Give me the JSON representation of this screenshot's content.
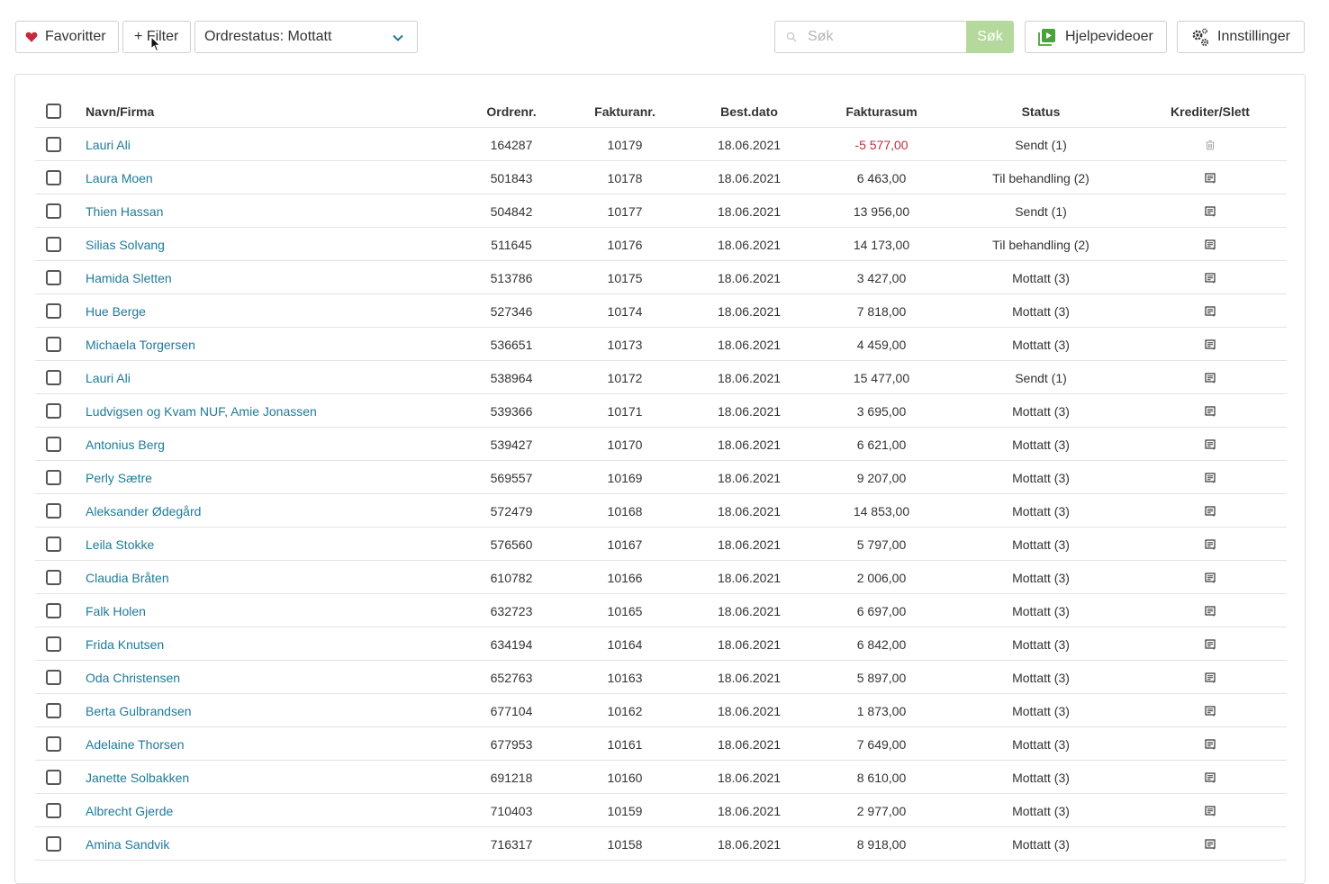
{
  "toolbar": {
    "favorites_label": "Favoritter",
    "filter_label": "+ Filter",
    "status_select_value": "Ordrestatus: Mottatt",
    "search_placeholder": "Søk",
    "search_button_label": "Søk",
    "help_videos_label": "Hjelpevideoer",
    "settings_label": "Innstillinger"
  },
  "colors": {
    "accent_link": "#1f7a99",
    "negative_amount": "#b8303f",
    "search_button": "#b5d99c",
    "heart": "#c8283c",
    "help_icon": "#4aa33a"
  },
  "table": {
    "headers": {
      "name": "Navn/Firma",
      "order_no": "Ordrenr.",
      "invoice_no": "Fakturanr.",
      "order_date": "Best.dato",
      "invoice_sum": "Fakturasum",
      "status": "Status",
      "credit_delete": "Krediter/Slett"
    },
    "rows": [
      {
        "name": "Lauri Ali",
        "order_no": "164287",
        "invoice_no": "10179",
        "date": "18.06.2021",
        "sum": "-5 577,00",
        "status": "Sendt (1)",
        "action_icon": "trash-icon"
      },
      {
        "name": "Laura Moen",
        "order_no": "501843",
        "invoice_no": "10178",
        "date": "18.06.2021",
        "sum": "6 463,00",
        "status": "Til behandling (2)",
        "action_icon": "credit-note-icon"
      },
      {
        "name": "Thien Hassan",
        "order_no": "504842",
        "invoice_no": "10177",
        "date": "18.06.2021",
        "sum": "13 956,00",
        "status": "Sendt (1)",
        "action_icon": "credit-note-icon"
      },
      {
        "name": "Silias Solvang",
        "order_no": "511645",
        "invoice_no": "10176",
        "date": "18.06.2021",
        "sum": "14 173,00",
        "status": "Til behandling (2)",
        "action_icon": "credit-note-icon"
      },
      {
        "name": "Hamida Sletten",
        "order_no": "513786",
        "invoice_no": "10175",
        "date": "18.06.2021",
        "sum": "3 427,00",
        "status": "Mottatt (3)",
        "action_icon": "credit-note-icon"
      },
      {
        "name": "Hue Berge",
        "order_no": "527346",
        "invoice_no": "10174",
        "date": "18.06.2021",
        "sum": "7 818,00",
        "status": "Mottatt (3)",
        "action_icon": "credit-note-icon"
      },
      {
        "name": "Michaela Torgersen",
        "order_no": "536651",
        "invoice_no": "10173",
        "date": "18.06.2021",
        "sum": "4 459,00",
        "status": "Mottatt (3)",
        "action_icon": "credit-note-icon"
      },
      {
        "name": "Lauri Ali",
        "order_no": "538964",
        "invoice_no": "10172",
        "date": "18.06.2021",
        "sum": "15 477,00",
        "status": "Sendt (1)",
        "action_icon": "credit-note-icon"
      },
      {
        "name": "Ludvigsen og Kvam NUF, Amie Jonassen",
        "order_no": "539366",
        "invoice_no": "10171",
        "date": "18.06.2021",
        "sum": "3 695,00",
        "status": "Mottatt (3)",
        "action_icon": "credit-note-icon"
      },
      {
        "name": "Antonius Berg",
        "order_no": "539427",
        "invoice_no": "10170",
        "date": "18.06.2021",
        "sum": "6 621,00",
        "status": "Mottatt (3)",
        "action_icon": "credit-note-icon"
      },
      {
        "name": "Perly Sætre",
        "order_no": "569557",
        "invoice_no": "10169",
        "date": "18.06.2021",
        "sum": "9 207,00",
        "status": "Mottatt (3)",
        "action_icon": "credit-note-icon"
      },
      {
        "name": "Aleksander Ødegård",
        "order_no": "572479",
        "invoice_no": "10168",
        "date": "18.06.2021",
        "sum": "14 853,00",
        "status": "Mottatt (3)",
        "action_icon": "credit-note-icon"
      },
      {
        "name": "Leila Stokke",
        "order_no": "576560",
        "invoice_no": "10167",
        "date": "18.06.2021",
        "sum": "5 797,00",
        "status": "Mottatt (3)",
        "action_icon": "credit-note-icon"
      },
      {
        "name": "Claudia Bråten",
        "order_no": "610782",
        "invoice_no": "10166",
        "date": "18.06.2021",
        "sum": "2 006,00",
        "status": "Mottatt (3)",
        "action_icon": "credit-note-icon"
      },
      {
        "name": "Falk Holen",
        "order_no": "632723",
        "invoice_no": "10165",
        "date": "18.06.2021",
        "sum": "6 697,00",
        "status": "Mottatt (3)",
        "action_icon": "credit-note-icon"
      },
      {
        "name": "Frida Knutsen",
        "order_no": "634194",
        "invoice_no": "10164",
        "date": "18.06.2021",
        "sum": "6 842,00",
        "status": "Mottatt (3)",
        "action_icon": "credit-note-icon"
      },
      {
        "name": "Oda Christensen",
        "order_no": "652763",
        "invoice_no": "10163",
        "date": "18.06.2021",
        "sum": "5 897,00",
        "status": "Mottatt (3)",
        "action_icon": "credit-note-icon"
      },
      {
        "name": "Berta Gulbrandsen",
        "order_no": "677104",
        "invoice_no": "10162",
        "date": "18.06.2021",
        "sum": "1 873,00",
        "status": "Mottatt (3)",
        "action_icon": "credit-note-icon"
      },
      {
        "name": "Adelaine Thorsen",
        "order_no": "677953",
        "invoice_no": "10161",
        "date": "18.06.2021",
        "sum": "7 649,00",
        "status": "Mottatt (3)",
        "action_icon": "credit-note-icon"
      },
      {
        "name": "Janette Solbakken",
        "order_no": "691218",
        "invoice_no": "10160",
        "date": "18.06.2021",
        "sum": "8 610,00",
        "status": "Mottatt (3)",
        "action_icon": "credit-note-icon"
      },
      {
        "name": "Albrecht Gjerde",
        "order_no": "710403",
        "invoice_no": "10159",
        "date": "18.06.2021",
        "sum": "2 977,00",
        "status": "Mottatt (3)",
        "action_icon": "credit-note-icon"
      },
      {
        "name": "Amina Sandvik",
        "order_no": "716317",
        "invoice_no": "10158",
        "date": "18.06.2021",
        "sum": "8 918,00",
        "status": "Mottatt (3)",
        "action_icon": "credit-note-icon"
      }
    ]
  }
}
